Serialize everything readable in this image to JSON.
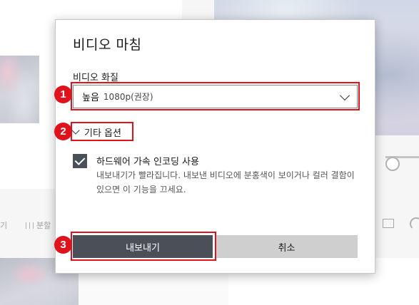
{
  "background": {
    "toolbar_left_label": "기",
    "toolbar_split_label": "분할"
  },
  "dialog": {
    "title": "비디오 마침",
    "quality": {
      "label": "비디오 화질",
      "selected_main": "높음",
      "selected_detail": "1080p(권장)"
    },
    "more_options": {
      "label": "기타 옵션",
      "expanded": true
    },
    "hardware_encoding": {
      "label": "하드웨어 가속 인코딩 사용",
      "checked": true,
      "description": "내보내기가 빨라집니다. 내보낸 비디오에 분홍색이 보이거나 컬러 결함이 있으면 이 기능을 끄세요."
    },
    "buttons": {
      "export_label": "내보내기",
      "cancel_label": "취소"
    }
  },
  "annotations": {
    "markers": [
      "1",
      "2",
      "3"
    ],
    "color": "#e0121b"
  },
  "colors": {
    "primary_button": "#4b5058",
    "secondary_button": "#cfcfcf",
    "checkbox": "#4a5058"
  }
}
